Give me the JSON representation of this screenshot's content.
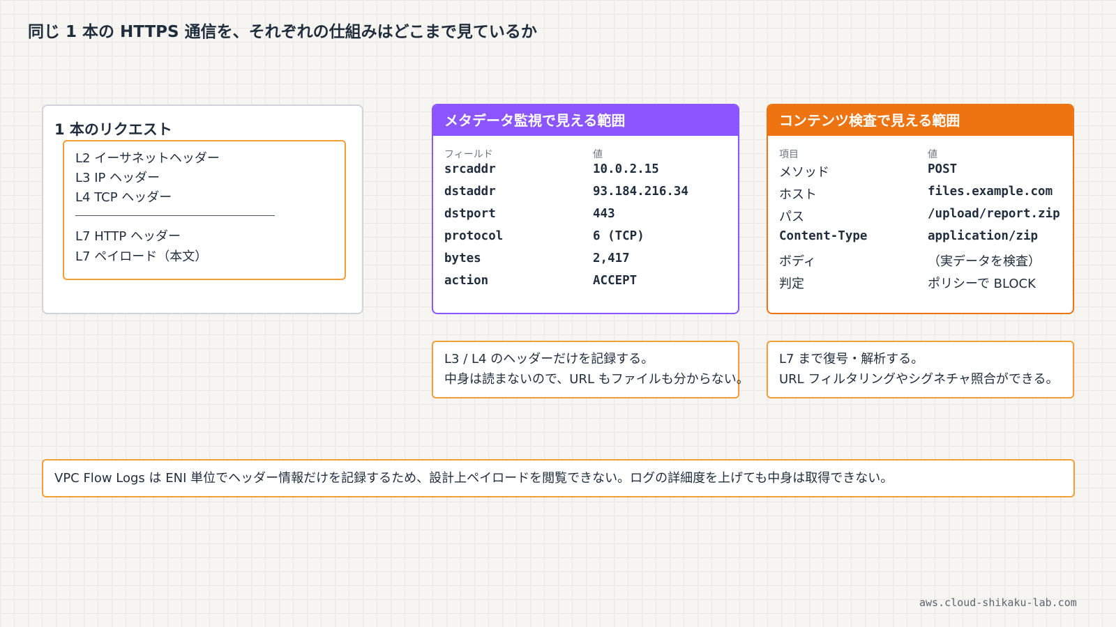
{
  "title": "同じ 1 本の HTTPS 通信を、それぞれの仕組みはどこまで見ているか",
  "request": {
    "title": "1 本のリクエスト",
    "layers_top": [
      "L2 イーサネットヘッダー",
      "L3 IP ヘッダー",
      "L4 TCP ヘッダー"
    ],
    "layers_bottom": [
      "L7 HTTP ヘッダー",
      "L7 ペイロード（本文）"
    ]
  },
  "metadata_panel": {
    "title": "メタデータ監視で見える範囲",
    "accent_color": "#8b55ff",
    "col_headers": [
      "フィールド",
      "値"
    ],
    "rows": [
      {
        "key": "srcaddr",
        "value": "10.0.2.15"
      },
      {
        "key": "dstaddr",
        "value": "93.184.216.34"
      },
      {
        "key": "dstport",
        "value": "443"
      },
      {
        "key": "protocol",
        "value": "6 (TCP)"
      },
      {
        "key": "bytes",
        "value": "2,417"
      },
      {
        "key": "action",
        "value": "ACCEPT"
      }
    ]
  },
  "content_panel": {
    "title": "コンテンツ検査で見える範囲",
    "accent_color": "#ee7411",
    "col_headers": [
      "項目",
      "値"
    ],
    "rows": [
      {
        "key": "メソッド",
        "value": "POST"
      },
      {
        "key": "ホスト",
        "value": "files.example.com"
      },
      {
        "key": "パス",
        "value": "/upload/report.zip"
      },
      {
        "key": "Content-Type",
        "value": "application/zip"
      },
      {
        "key": "ボディ",
        "value": "（実データを検査）"
      },
      {
        "key": "判定",
        "value": "ポリシーで BLOCK"
      }
    ]
  },
  "notes": {
    "metadata": [
      "L3 / L4 のヘッダーだけを記録する。",
      "中身は読まないので、URL もファイルも分からない。"
    ],
    "content": [
      "L7 まで復号・解析する。",
      "URL フィルタリングやシグネチャ照合ができる。"
    ]
  },
  "summary": "VPC Flow Logs は ENI 単位でヘッダー情報だけを記録するため、設計上ペイロードを閲覧できない。ログの詳細度を上げても中身は取得できない。",
  "footer": "aws.cloud-shikaku-lab.com"
}
